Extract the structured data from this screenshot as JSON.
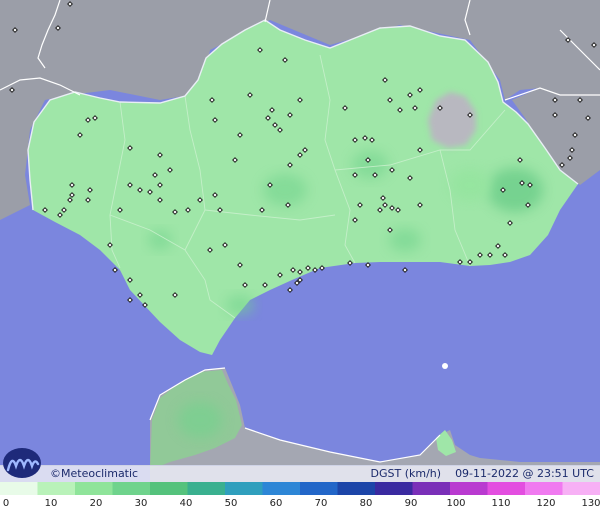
{
  "credit": "©Meteoclimatic",
  "variable_label": "DGST (km/h)",
  "timestamp": "09-11-2022 @ 23:51 UTC",
  "legend": {
    "ticks": [
      "0",
      "10",
      "20",
      "30",
      "40",
      "50",
      "60",
      "70",
      "80",
      "90",
      "100",
      "110",
      "120",
      "130"
    ],
    "colors": [
      "#e8fbe8",
      "#b9f2b9",
      "#8fe49a",
      "#6fd38c",
      "#55c27c",
      "#3ab08f",
      "#2f9fbd",
      "#2d86d6",
      "#2266c8",
      "#1c45a8",
      "#3a2aa0",
      "#7a2fb8",
      "#b93ad0",
      "#e34ee0",
      "#f07af0",
      "#f7b0f5"
    ]
  },
  "map_colors": {
    "sea": "#7b86de",
    "land_outside": "#9b9ea8",
    "region": "#9fe6a8",
    "mountain": "#b8b8c0",
    "station_marker": "#111111"
  }
}
